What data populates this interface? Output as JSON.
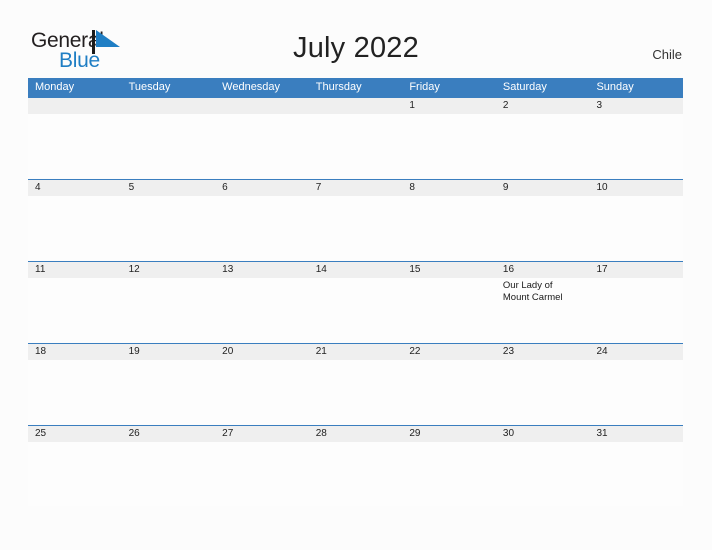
{
  "brand": {
    "name_part1": "General",
    "name_part2": "Blue",
    "mark_icon": "blue-flag-triangle-icon",
    "color_dark": "#231f20",
    "color_blue": "#1f7ec4"
  },
  "header": {
    "title": "July 2022",
    "country": "Chile"
  },
  "theme": {
    "header_blue": "#3a7ebf",
    "date_band_gray": "#efefef",
    "page_background": "#fcfcfc",
    "text_dark": "#222222"
  },
  "calendar": {
    "weekdays": [
      "Monday",
      "Tuesday",
      "Wednesday",
      "Thursday",
      "Friday",
      "Saturday",
      "Sunday"
    ],
    "weeks": [
      {
        "days": [
          {
            "num": "",
            "event": ""
          },
          {
            "num": "",
            "event": ""
          },
          {
            "num": "",
            "event": ""
          },
          {
            "num": "",
            "event": ""
          },
          {
            "num": "1",
            "event": ""
          },
          {
            "num": "2",
            "event": ""
          },
          {
            "num": "3",
            "event": ""
          }
        ]
      },
      {
        "days": [
          {
            "num": "4",
            "event": ""
          },
          {
            "num": "5",
            "event": ""
          },
          {
            "num": "6",
            "event": ""
          },
          {
            "num": "7",
            "event": ""
          },
          {
            "num": "8",
            "event": ""
          },
          {
            "num": "9",
            "event": ""
          },
          {
            "num": "10",
            "event": ""
          }
        ]
      },
      {
        "days": [
          {
            "num": "11",
            "event": ""
          },
          {
            "num": "12",
            "event": ""
          },
          {
            "num": "13",
            "event": ""
          },
          {
            "num": "14",
            "event": ""
          },
          {
            "num": "15",
            "event": ""
          },
          {
            "num": "16",
            "event": "Our Lady of Mount Carmel"
          },
          {
            "num": "17",
            "event": ""
          }
        ]
      },
      {
        "days": [
          {
            "num": "18",
            "event": ""
          },
          {
            "num": "19",
            "event": ""
          },
          {
            "num": "20",
            "event": ""
          },
          {
            "num": "21",
            "event": ""
          },
          {
            "num": "22",
            "event": ""
          },
          {
            "num": "23",
            "event": ""
          },
          {
            "num": "24",
            "event": ""
          }
        ]
      },
      {
        "days": [
          {
            "num": "25",
            "event": ""
          },
          {
            "num": "26",
            "event": ""
          },
          {
            "num": "27",
            "event": ""
          },
          {
            "num": "28",
            "event": ""
          },
          {
            "num": "29",
            "event": ""
          },
          {
            "num": "30",
            "event": ""
          },
          {
            "num": "31",
            "event": ""
          }
        ]
      }
    ]
  }
}
